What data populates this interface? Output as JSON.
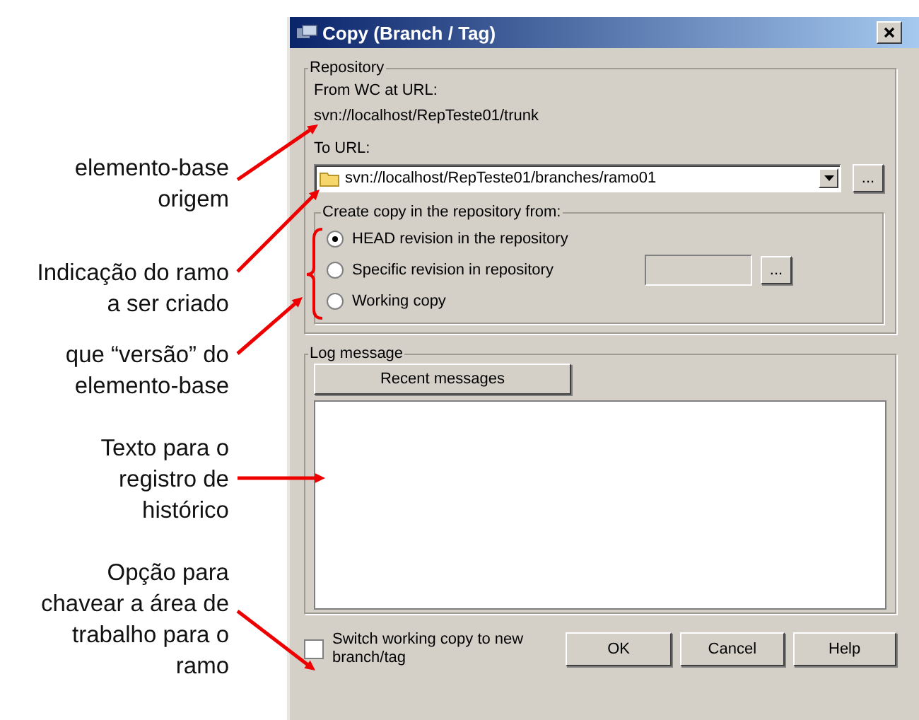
{
  "annotations": [
    {
      "text": "elemento-base\norigem"
    },
    {
      "text": "Indicação do ramo\na ser criado"
    },
    {
      "text": "que “versão” do\nelemento-base"
    },
    {
      "text": "Texto para o\nregistro de\nhistórico"
    },
    {
      "text": "Opção para\nchavear a área de\ntrabalho para  o\nramo"
    }
  ],
  "dialog": {
    "title": "Copy (Branch / Tag)",
    "repository": {
      "legend": "Repository",
      "from_label": "From WC at URL:",
      "from_url": "svn://localhost/RepTeste01/trunk",
      "to_label": "To URL:",
      "to_url": "svn://localhost/RepTeste01/branches/ramo01",
      "browse": "..."
    },
    "copy_from": {
      "legend": "Create copy in the repository from:",
      "revision_browse": "...",
      "options": [
        {
          "label": "HEAD revision in the repository",
          "selected": true,
          "kind": "plain"
        },
        {
          "label": "Specific revision in repository",
          "selected": false,
          "kind": "revision"
        },
        {
          "label": "Working copy",
          "selected": false,
          "kind": "plain"
        }
      ]
    },
    "log": {
      "legend": "Log message",
      "recent_button": "Recent messages"
    },
    "switch": {
      "label": "Switch working copy to new branch/tag",
      "checked": false
    },
    "buttons": [
      "OK",
      "Cancel",
      "Help"
    ]
  }
}
